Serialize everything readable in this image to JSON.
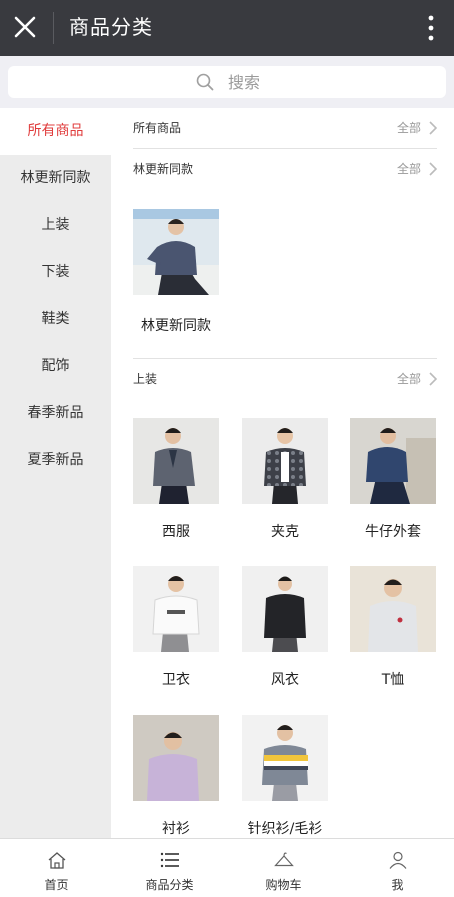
{
  "header": {
    "title": "商品分类",
    "close_icon": "close-icon",
    "more_icon": "more-vertical-icon"
  },
  "search": {
    "placeholder": "搜索",
    "icon": "search-icon"
  },
  "sidebar": {
    "items": [
      {
        "label": "所有商品",
        "active": true
      },
      {
        "label": "林更新同款"
      },
      {
        "label": "上装"
      },
      {
        "label": "下装"
      },
      {
        "label": "鞋类"
      },
      {
        "label": "配饰"
      },
      {
        "label": "春季新品"
      },
      {
        "label": "夏季新品"
      }
    ]
  },
  "sections": [
    {
      "title": "所有商品",
      "all_label": "全部"
    },
    {
      "title": "林更新同款",
      "all_label": "全部",
      "products": [
        {
          "name": "林更新同款"
        }
      ]
    },
    {
      "title": "上装",
      "all_label": "全部",
      "products": [
        {
          "name": "西服"
        },
        {
          "name": "夹克"
        },
        {
          "name": "牛仔外套"
        },
        {
          "name": "卫衣"
        },
        {
          "name": "风衣"
        },
        {
          "name": "T恤"
        },
        {
          "name": "衬衫"
        },
        {
          "name": "针织衫/毛衫"
        }
      ]
    }
  ],
  "tabbar": {
    "tabs": [
      {
        "label": "首页",
        "icon": "home-icon"
      },
      {
        "label": "商品分类",
        "icon": "list-icon"
      },
      {
        "label": "购物车",
        "icon": "hanger-icon"
      },
      {
        "label": "我",
        "icon": "user-icon"
      }
    ]
  },
  "colors": {
    "topbar": "#393a3f",
    "active": "#e03c3c",
    "sidebar_bg": "#ececec"
  }
}
